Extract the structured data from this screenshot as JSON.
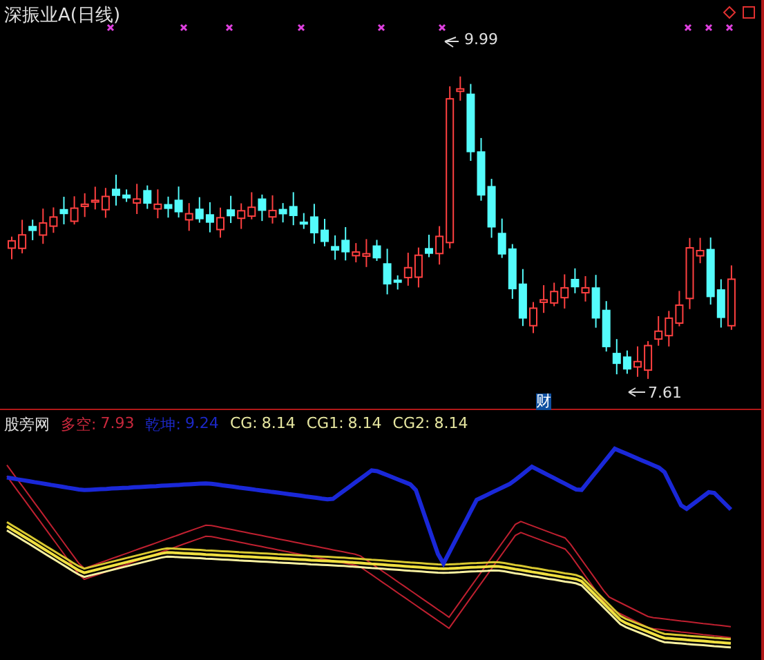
{
  "main_chart": {
    "title": "深振业A(日线)",
    "high_label": "9.99",
    "low_label": "7.61",
    "event_marker": "财"
  },
  "indicator": {
    "name": "股旁网",
    "readouts": [
      {
        "label": "多空:",
        "value": "7.93",
        "color": "#c8283c"
      },
      {
        "label": "乾坤:",
        "value": "9.24",
        "color": "#1c28c8"
      },
      {
        "label": "CG:",
        "value": "8.14",
        "color": "#e6e6a0"
      },
      {
        "label": "CG1:",
        "value": "8.14",
        "color": "#e6e6a0"
      },
      {
        "label": "CG2:",
        "value": "8.14",
        "color": "#e6e6a0"
      }
    ]
  }
}
